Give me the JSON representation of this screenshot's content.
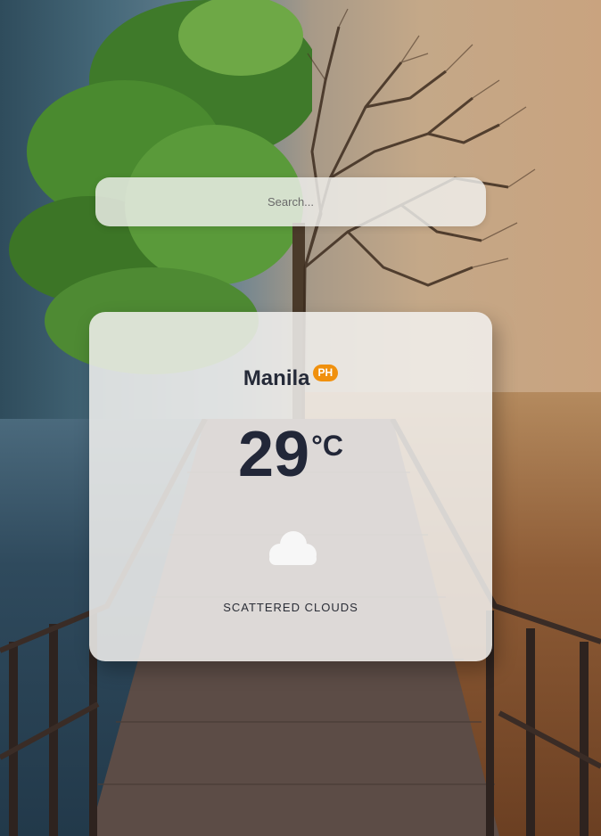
{
  "search": {
    "placeholder": "Search...",
    "value": ""
  },
  "weather": {
    "city": "Manila",
    "country_code": "PH",
    "temperature": "29",
    "unit": "°C",
    "condition_icon": "cloud-icon",
    "description": "SCATTERED CLOUDS"
  },
  "colors": {
    "badge": "#f0900d",
    "text_dark": "#222738",
    "card_bg": "#f2f1ef"
  }
}
